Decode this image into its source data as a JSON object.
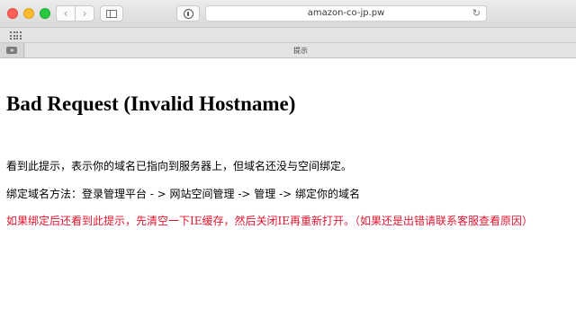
{
  "browser": {
    "address": "amazon-co-jp.pw",
    "tab_title": "提示",
    "icons": {
      "back": "chevron-left-icon",
      "forward": "chevron-right-icon",
      "sidebar": "sidebar-icon",
      "privacy": "privacy-report-icon",
      "reload": "reload-icon",
      "favorites": "grid-icon",
      "pinned_tab": "video-icon"
    }
  },
  "page": {
    "title": "Bad Request (Invalid Hostname)",
    "line1": "看到此提示，表示你的域名已指向到服务器上，但域名还没与空间绑定。",
    "line2": "绑定域名方法：登录管理平台 - > 网站空间管理 -> 管理 -> 绑定你的域名",
    "line3": "如果绑定后还看到此提示，先清空一下IE缓存，然后关闭IE再重新打开。（如果还是出错请联系客服查看原因）",
    "warning_color": "#e0152f"
  }
}
